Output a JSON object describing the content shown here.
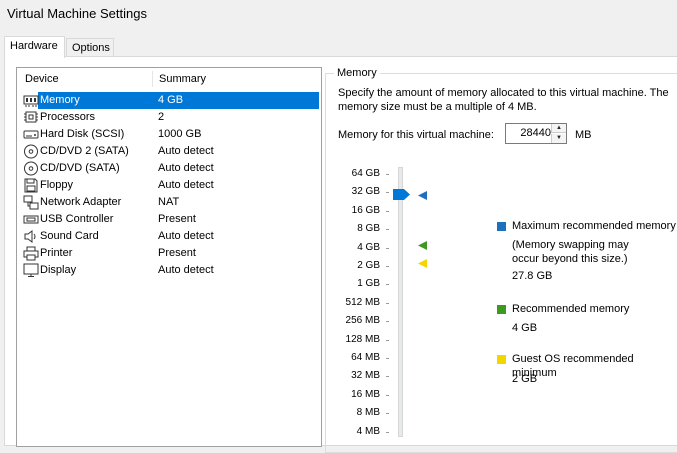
{
  "window": {
    "title": "Virtual Machine Settings"
  },
  "tabs": [
    {
      "label": "Hardware",
      "active": true
    },
    {
      "label": "Options",
      "active": false
    }
  ],
  "device_list": {
    "headers": {
      "device": "Device",
      "summary": "Summary"
    },
    "rows": [
      {
        "icon": "memory-icon",
        "device": "Memory",
        "summary": "4 GB",
        "selected": true
      },
      {
        "icon": "processor-icon",
        "device": "Processors",
        "summary": "2"
      },
      {
        "icon": "hard-disk-icon",
        "device": "Hard Disk (SCSI)",
        "summary": "1000 GB"
      },
      {
        "icon": "cd-dvd-icon",
        "device": "CD/DVD 2 (SATA)",
        "summary": "Auto detect"
      },
      {
        "icon": "cd-dvd-icon",
        "device": "CD/DVD (SATA)",
        "summary": "Auto detect"
      },
      {
        "icon": "floppy-icon",
        "device": "Floppy",
        "summary": "Auto detect"
      },
      {
        "icon": "network-adapter-icon",
        "device": "Network Adapter",
        "summary": "NAT"
      },
      {
        "icon": "usb-icon",
        "device": "USB Controller",
        "summary": "Present"
      },
      {
        "icon": "speaker-icon",
        "device": "Sound Card",
        "summary": "Auto detect"
      },
      {
        "icon": "printer-icon",
        "device": "Printer",
        "summary": "Present"
      },
      {
        "icon": "display-icon",
        "device": "Display",
        "summary": "Auto detect"
      }
    ]
  },
  "memory": {
    "group_label": "Memory",
    "description": "Specify the amount of memory allocated to this virtual machine. The memory size must be a multiple of 4 MB.",
    "field_label": "Memory for this virtual machine:",
    "value": "28440",
    "unit": "MB",
    "scale_ticks": [
      "64 GB",
      "32 GB",
      "16 GB",
      "8 GB",
      "4 GB",
      "2 GB",
      "1 GB",
      "512 MB",
      "256 MB",
      "128 MB",
      "64 MB",
      "32 MB",
      "16 MB",
      "8 MB",
      "4 MB"
    ],
    "legend": {
      "max": {
        "title": "Maximum recommended memory",
        "note": "(Memory swapping may occur beyond this size.)",
        "value": "27.8 GB",
        "color": "#1f6fbf"
      },
      "recommended": {
        "title": "Recommended memory",
        "value": "4 GB",
        "color": "#3c9a22"
      },
      "guest_min": {
        "title": "Guest OS recommended minimum",
        "value": "2 GB",
        "color": "#f2d600"
      }
    },
    "slider_color": "#0078d7"
  }
}
